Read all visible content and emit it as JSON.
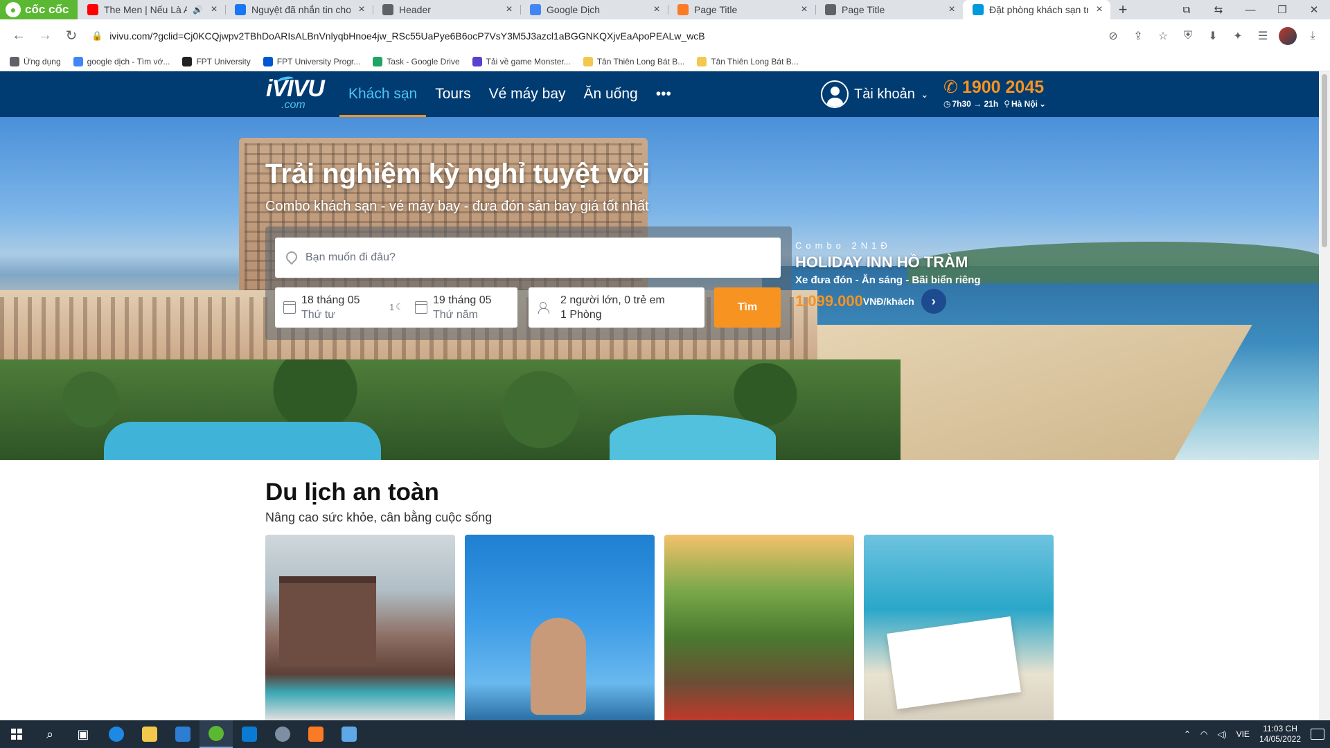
{
  "browser": {
    "brand": "cốc cốc",
    "tabs": [
      {
        "title": "The Men | Nếu Là Anh",
        "favicon": "youtube-icon",
        "color": "#ff0000",
        "audio": true
      },
      {
        "title": "Nguyệt đã nhắn tin cho bạn",
        "favicon": "facebook-icon",
        "color": "#1877f2"
      },
      {
        "title": "Header",
        "favicon": "globe-icon",
        "color": "#5f6368"
      },
      {
        "title": "Google Dịch",
        "favicon": "google-translate-icon",
        "color": "#4285f4"
      },
      {
        "title": "Page Title",
        "favicon": "xampp-icon",
        "color": "#fb7a24"
      },
      {
        "title": "Page Title",
        "favicon": "globe-icon",
        "color": "#5f6368"
      },
      {
        "title": "Đặt phòng khách sạn trực tuyến",
        "favicon": "ivivu-icon",
        "color": "#0099dd",
        "active": true
      }
    ],
    "url": "ivivu.com/?gclid=Cj0KCQjwpv2TBhDoARIsALBnVnlyqbHnoe4jw_RSc55UaPye6B6ocP7VsY3M5J3azcl1aBGGNKQXjvEaApoPEALw_wcB",
    "bookmarks": [
      {
        "label": "Ứng dụng",
        "icon": "apps-grid-icon",
        "color": "#5f6368"
      },
      {
        "label": "google dịch - Tìm vớ...",
        "icon": "google-icon",
        "color": "#4285f4"
      },
      {
        "label": "FPT University",
        "icon": "fpt-icon",
        "color": "#222222"
      },
      {
        "label": "FPT University Progr...",
        "icon": "coursera-icon",
        "color": "#0056d2"
      },
      {
        "label": "Task - Google Drive",
        "icon": "drive-icon",
        "color": "#1fa463"
      },
      {
        "label": "Tải về game Monster...",
        "icon": "monster-icon",
        "color": "#5a3fd1"
      },
      {
        "label": "Tân Thiên Long Bát B...",
        "icon": "folder-icon",
        "color": "#f2c94c"
      },
      {
        "label": "Tân Thiên Long Bát B...",
        "icon": "folder-icon",
        "color": "#f2c94c"
      }
    ]
  },
  "site": {
    "logo_main": "iVIVU",
    "logo_sub": ".com",
    "menu": [
      {
        "label": "Khách sạn",
        "active": true
      },
      {
        "label": "Tours"
      },
      {
        "label": "Vé máy bay"
      },
      {
        "label": "Ăn uống"
      },
      {
        "label": "•••"
      }
    ],
    "account_label": "Tài khoản",
    "hotline": "1900 2045",
    "hours": "7h30 → 21h",
    "city": "Hà Nội",
    "colors": {
      "navbar": "#003c71",
      "accent": "#f79321",
      "active_menu": "#4fc3f7"
    }
  },
  "hero": {
    "title": "Trải nghiệm kỳ nghỉ tuyệt vời",
    "subtitle": "Combo khách sạn - vé máy bay - đưa đón sân bay giá tốt nhất",
    "search_placeholder": "Bạn muốn đi đâu?",
    "checkin_date": "18 tháng 05",
    "checkin_day": "Thứ tư",
    "nights": "1",
    "checkout_date": "19 tháng 05",
    "checkout_day": "Thứ năm",
    "guests": "2 người lớn, 0 trẻ em",
    "rooms": "1 Phòng",
    "search_button": "Tìm"
  },
  "promo": {
    "tag": "Combo 2N1Đ",
    "name": "HOLIDAY INN HỒ TRÀM",
    "desc": "Xe đưa đón - Ăn sáng - Bãi biển riêng",
    "price": "1.099.000",
    "unit": "VNĐ/khách"
  },
  "section": {
    "title": "Du lịch an toàn",
    "subtitle": "Nâng cao sức khỏe, cân bằng cuộc sống"
  },
  "taskbar": {
    "lang": "VIE",
    "time": "11:03 CH",
    "date": "14/05/2022"
  }
}
